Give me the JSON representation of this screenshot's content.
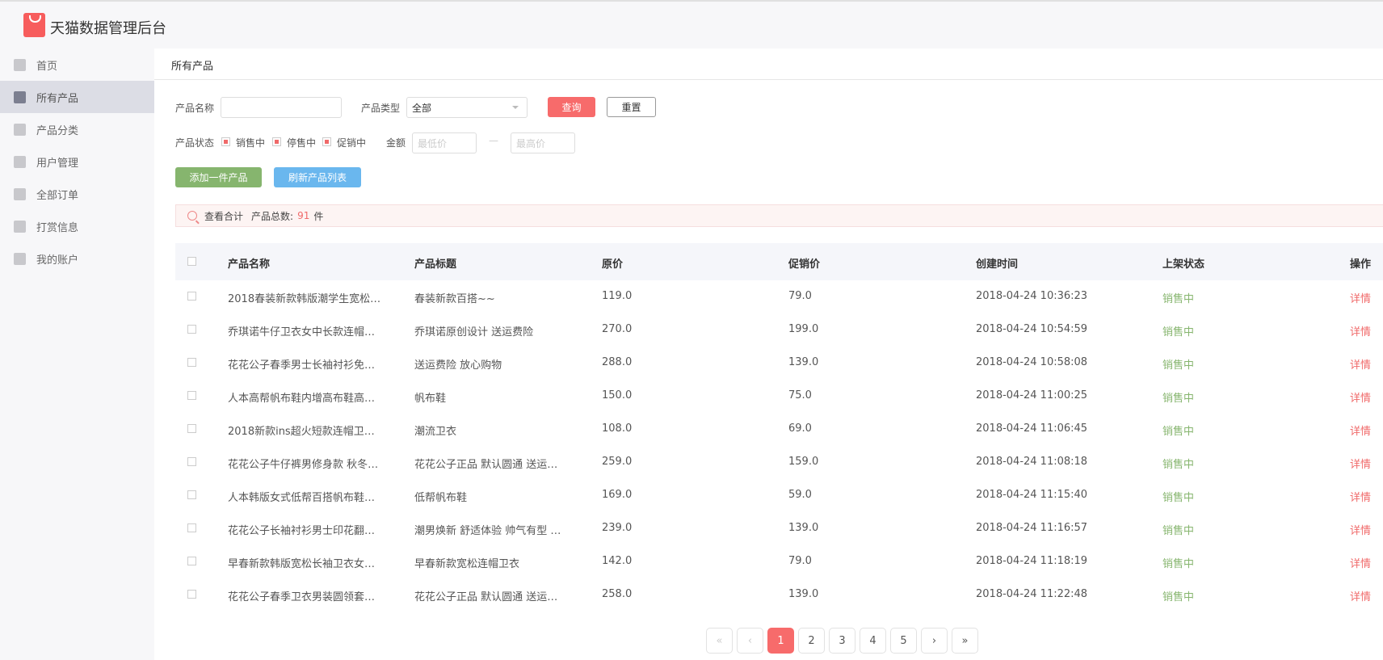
{
  "app": {
    "title": "天猫数据管理后台",
    "accent": "#f75d5d"
  },
  "sidebar": {
    "items": [
      {
        "label": "首页",
        "icon": "home-icon"
      },
      {
        "label": "所有产品",
        "icon": "bag-icon",
        "active": true
      },
      {
        "label": "产品分类",
        "icon": "grid-icon"
      },
      {
        "label": "用户管理",
        "icon": "user-icon"
      },
      {
        "label": "全部订单",
        "icon": "clipboard-icon"
      },
      {
        "label": "打赏信息",
        "icon": "coin-icon"
      },
      {
        "label": "我的账户",
        "icon": "gear-icon"
      }
    ]
  },
  "breadcrumb": "所有产品",
  "filters": {
    "name_label": "产品名称",
    "name_value": "",
    "type_label": "产品类型",
    "type_value": "全部",
    "query": "查询",
    "reset": "重置",
    "status_label": "产品状态",
    "statuses": [
      "销售中",
      "停售中",
      "促销中"
    ],
    "amount_label": "金额",
    "min_placeholder": "最低价",
    "max_placeholder": "最高价",
    "dash": "—"
  },
  "actions": {
    "add": "添加一件产品",
    "refresh": "刷新产品列表"
  },
  "summary": {
    "label": "查看合计",
    "total_label": "产品总数:",
    "total": "91",
    "unit": "件"
  },
  "table": {
    "headers": [
      "产品名称",
      "产品标题",
      "原价",
      "促销价",
      "创建时间",
      "上架状态",
      "操作"
    ],
    "rows": [
      [
        "2018春装新款韩版潮学生宽松…",
        "春装新款百搭~~",
        "119.0",
        "79.0",
        "2018-04-24 10:36:23",
        "销售中",
        "详情"
      ],
      [
        "乔琪诺牛仔卫衣女中长款连帽…",
        "乔琪诺原创设计 送运费险",
        "270.0",
        "199.0",
        "2018-04-24 10:54:59",
        "销售中",
        "详情"
      ],
      [
        "花花公子春季男士长袖衬衫免…",
        "送运费险 放心购物",
        "288.0",
        "139.0",
        "2018-04-24 10:58:08",
        "销售中",
        "详情"
      ],
      [
        "人本高帮帆布鞋内增高布鞋高…",
        "帆布鞋",
        "150.0",
        "75.0",
        "2018-04-24 11:00:25",
        "销售中",
        "详情"
      ],
      [
        "2018新款ins超火短款连帽卫…",
        "潮流卫衣",
        "108.0",
        "69.0",
        "2018-04-24 11:06:45",
        "销售中",
        "详情"
      ],
      [
        "花花公子牛仔裤男修身款 秋冬…",
        "花花公子正品 默认圆通 送运…",
        "259.0",
        "159.0",
        "2018-04-24 11:08:18",
        "销售中",
        "详情"
      ],
      [
        "人本韩版女式低帮百搭帆布鞋…",
        "低帮帆布鞋",
        "169.0",
        "59.0",
        "2018-04-24 11:15:40",
        "销售中",
        "详情"
      ],
      [
        "花花公子长袖衬衫男士印花翻…",
        "潮男焕新 舒适体验 帅气有型 …",
        "239.0",
        "139.0",
        "2018-04-24 11:16:57",
        "销售中",
        "详情"
      ],
      [
        "早春新款韩版宽松长袖卫衣女…",
        "早春新款宽松连帽卫衣",
        "142.0",
        "79.0",
        "2018-04-24 11:18:19",
        "销售中",
        "详情"
      ],
      [
        "花花公子春季卫衣男装圆领套…",
        "花花公子正品 默认圆通 送运…",
        "258.0",
        "139.0",
        "2018-04-24 11:22:48",
        "销售中",
        "详情"
      ]
    ]
  },
  "pagination": {
    "first": "«",
    "prev": "‹",
    "pages": [
      "1",
      "2",
      "3",
      "4",
      "5"
    ],
    "current": "1",
    "next": "›",
    "last": "»"
  }
}
